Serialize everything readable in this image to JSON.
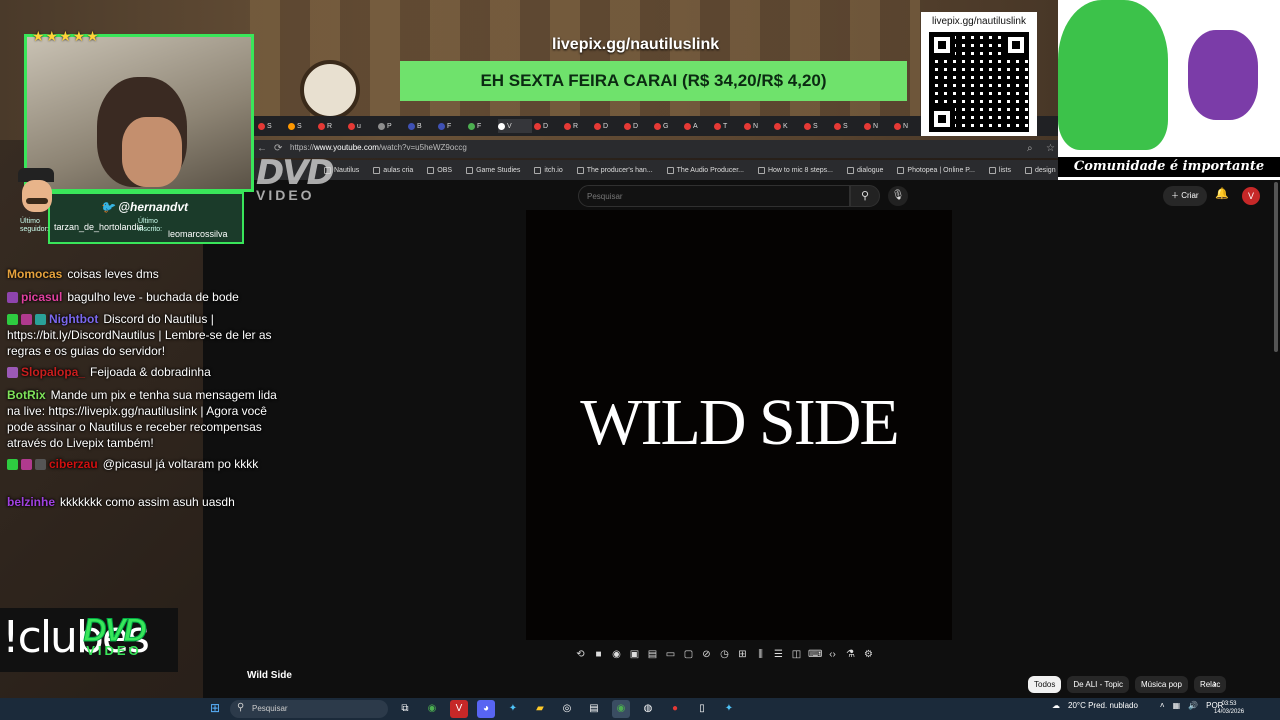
{
  "overlay": {
    "stars": "★★★★★",
    "twitter_handle": "@hernandvt",
    "last_follower_label": "Último seguidor:",
    "last_follower": "tarzan_de_hortolandia",
    "last_sub_label": "Último inscrito:",
    "last_sub": "leomarcossilva",
    "livepix_url": "livepix.gg/nautiluslink",
    "banner_text": "EH SEXTA FEIRA CARAI (R$ 34,20/R$ 4,20)",
    "qr_title": "livepix.gg/nautiluslink",
    "pixel_caption": "Comunidade é importante",
    "clubes_text": "!clubes",
    "dvd_big": "DVD",
    "dvd_small": "VIDEO"
  },
  "chat": [
    {
      "user": "Momocas",
      "user_color": "#e6a23c",
      "text": "coisas leves dms",
      "badges": []
    },
    {
      "user": "picasul",
      "user_color": "#e0409f",
      "text": "bagulho leve - buchada de bode",
      "badges": [
        "#8e44ad"
      ]
    },
    {
      "user": "Nightbot",
      "user_color": "#7b68ee",
      "text": "Discord do Nautilus | https://bit.ly/DiscordNautilus | Lembre-se de ler as regras e os guias do servidor!",
      "badges": [
        "#2ecc40",
        "#b03a8e",
        "#2aa198"
      ]
    },
    {
      "user": "Slopalopa_",
      "user_color": "#c81e1e",
      "text": "Feijoada & dobradinha",
      "badges": [
        "#9b59b6"
      ]
    },
    {
      "user": "BotRix",
      "user_color": "#7fe35a",
      "text": "Mande um pix e tenha sua mensagem lida na live: https://livepix.gg/nautiluslink | Agora você pode assinar o Nautilus e receber recompensas através do Livepix também!",
      "badges": []
    },
    {
      "user": "ciberzau",
      "user_color": "#d01010",
      "text": "@picasul já voltaram po kkkk",
      "badges": [
        "#2ecc40",
        "#b03a8e",
        "#555555"
      ]
    },
    {
      "user": "belzinhe",
      "user_color": "#a040e0",
      "text": "kkkkkkk como assim asuh uasdh",
      "badges": []
    }
  ],
  "browser": {
    "url_prefix": "https://",
    "url_domain": "www.youtube.com",
    "url_path": "/watch?v=u5heWZ9occg",
    "tabs": [
      "S",
      "S",
      "R",
      "u",
      "P",
      "B",
      "F",
      "F",
      "V",
      "D",
      "R",
      "D",
      "D",
      "G",
      "A",
      "T",
      "N",
      "K",
      "S",
      "S",
      "N",
      "N",
      "T"
    ],
    "bookmarks": [
      "Nautilus",
      "aulas cria",
      "OBS",
      "Game Studies",
      "itch.io",
      "The producer's han...",
      "The Audio Producer...",
      "How to mic 8 steps...",
      "dialogue",
      "Photopea | Online P...",
      "lists",
      "design"
    ]
  },
  "youtube": {
    "search_placeholder": "Pesquisar",
    "create_label": "Criar",
    "avatar_letter": "V",
    "video_overlay_text": "WILD SIDE",
    "video_title": "Wild Side",
    "chips": [
      "Todos",
      "De ALI - Topic",
      "Música pop",
      "Relac"
    ]
  },
  "taskbar": {
    "search_placeholder": "Pesquisar",
    "weather": "20°C  Pred. nublado",
    "lang": "POR",
    "time": "03:53",
    "date": "14/03/2026"
  }
}
